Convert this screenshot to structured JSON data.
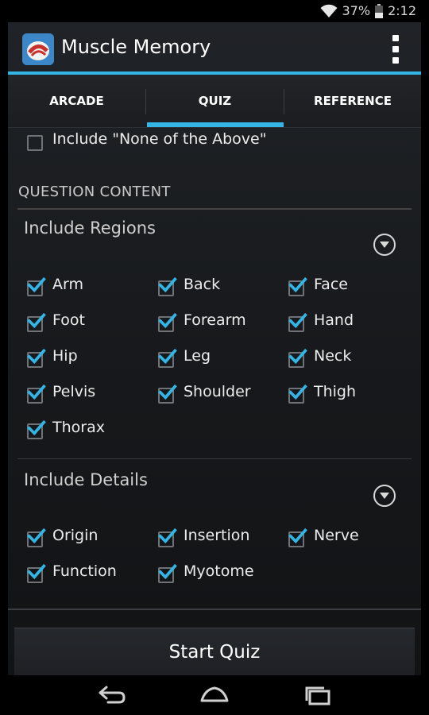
{
  "status": {
    "battery": "37%",
    "time": "2:12"
  },
  "app": {
    "title": "Muscle Memory"
  },
  "tabs": [
    {
      "label": "ARCADE"
    },
    {
      "label": "QUIZ"
    },
    {
      "label": "REFERENCE"
    }
  ],
  "options": {
    "none_of_above": "Include \"None of the Above\""
  },
  "sections": {
    "question_content": "QUESTION CONTENT"
  },
  "regions": {
    "title": "Include Regions",
    "items": [
      "Arm",
      "Back",
      "Face",
      "Foot",
      "Forearm",
      "Hand",
      "Hip",
      "Leg",
      "Neck",
      "Pelvis",
      "Shoulder",
      "Thigh",
      "Thorax"
    ]
  },
  "details": {
    "title": "Include Details",
    "items": [
      "Origin",
      "Insertion",
      "Nerve",
      "Function",
      "Myotome"
    ]
  },
  "start_button": "Start Quiz",
  "colors": {
    "accent": "#33b5e5",
    "background": "#1b1d20"
  }
}
